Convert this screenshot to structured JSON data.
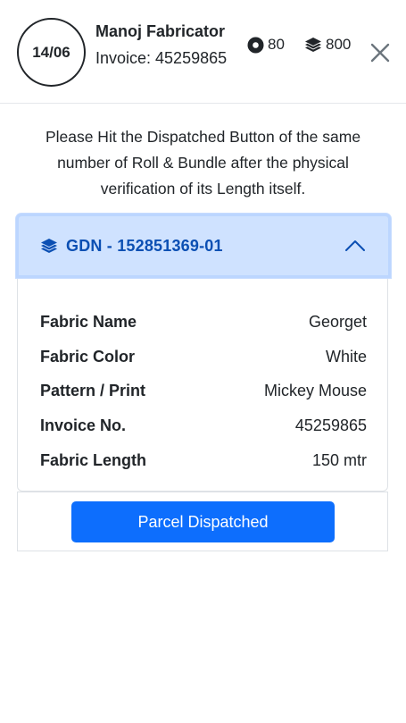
{
  "header": {
    "date_badge": "14/06",
    "fabricator_name": "Manoj Fabricator",
    "invoice_text": "Invoice: 45259865",
    "roll_count": "80",
    "bundle_count": "800"
  },
  "instruction": "Please Hit the Dispatched Button of the same number of Roll & Bundle after the physical verification of its Length itself.",
  "accordion": {
    "title": "GDN - 152851369-01",
    "details": [
      {
        "label": "Fabric Name",
        "value": "Georget"
      },
      {
        "label": "Fabric Color",
        "value": "White"
      },
      {
        "label": "Pattern / Print",
        "value": "Mickey Mouse"
      },
      {
        "label": "Invoice No.",
        "value": "45259865"
      },
      {
        "label": "Fabric Length",
        "value": "150 mtr"
      }
    ]
  },
  "actions": {
    "dispatch_label": "Parcel Dispatched"
  },
  "colors": {
    "primary": "#0d6efd",
    "accordion_bg": "#cfe2ff",
    "accordion_text": "#0b4fb3"
  },
  "icons": {
    "roll": "roll-icon",
    "bundle": "layers-icon",
    "close": "close-icon",
    "accordion": "layers-icon",
    "chevron": "chevron-up-icon"
  }
}
